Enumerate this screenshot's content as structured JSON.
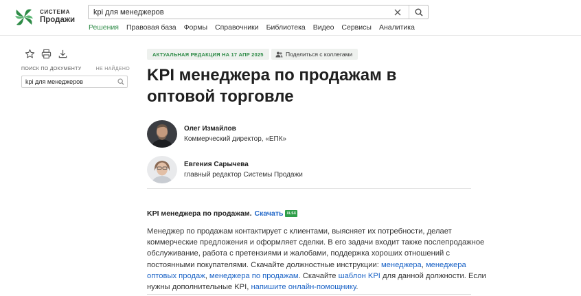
{
  "logo": {
    "line1": "Система",
    "line2": "Продажи",
    "icon": "leaf-pinwheel-logo",
    "brand_color": "#2e8b47"
  },
  "search": {
    "value": "kpi для менеджеров"
  },
  "nav": {
    "items": [
      "Решения",
      "Правовая база",
      "Формы",
      "Справочники",
      "Библиотека",
      "Видео",
      "Сервисы",
      "Аналитика"
    ],
    "active_index": 0
  },
  "doc_search": {
    "label": "Поиск по документу",
    "status": "Не найдено",
    "value": "kpi для менеджеров"
  },
  "badge": {
    "text": "Актуальная редакция на 17 апр 2025"
  },
  "share": {
    "text": "Поделиться с коллегами"
  },
  "title": "KPI менеджера по продажам в оптовой торговле",
  "authors": [
    {
      "name": "Олег Измайлов",
      "role": "Коммерческий директор, «ЕПК»"
    },
    {
      "name": "Евгения Сарычева",
      "role": "главный редактор Системы Продажи"
    }
  ],
  "download": {
    "label": "KPI менеджера по продажам.",
    "link": "Скачать",
    "format": "XLSX"
  },
  "body": {
    "t1": "Менеджер по продажам контактирует с клиентами, выясняет их потребности, делает коммерческие предложения и оформляет сделки. В его задачи входит также послепродажное обслуживание, работа с претензиями и жалобами, поддержка хороших отношений с постоянными покупателями. Скачайте должностные инструкции: ",
    "l1": "менеджера",
    "t2": ", ",
    "l2": "менеджера оптовых продаж",
    "t3": ", ",
    "l3": "менеджера по продажам",
    "t4": ". Скачайте ",
    "l4": "шаблон KPI",
    "t5": " для данной должности. Если нужны дополнительные KPI, ",
    "l5": "напишите онлайн-помощнику",
    "t6": "."
  },
  "colors": {
    "accent": "#2e8b47",
    "link": "#1b63c6",
    "badge_bg": "#eef1ee"
  }
}
